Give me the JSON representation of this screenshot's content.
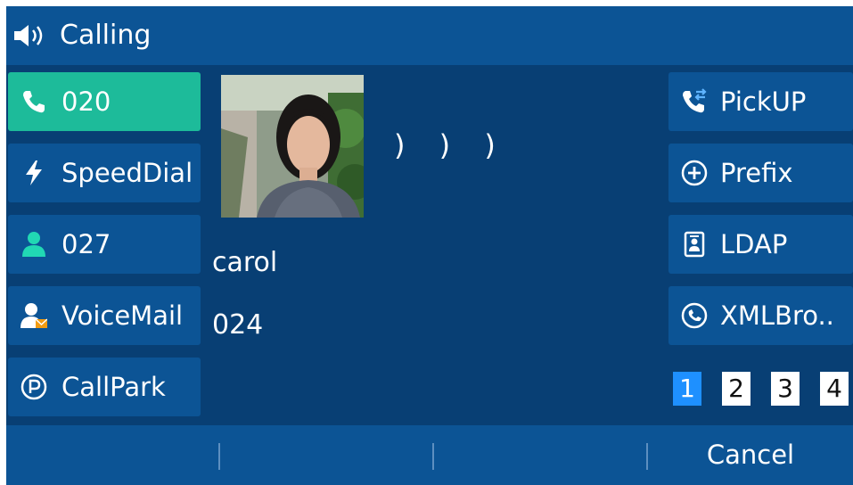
{
  "status": {
    "title": "Calling",
    "icon": "speaker-icon"
  },
  "left_buttons": [
    {
      "label": "020",
      "icon": "phone-icon",
      "active": true
    },
    {
      "label": "SpeedDial",
      "icon": "lightning-icon"
    },
    {
      "label": "027",
      "icon": "person-icon"
    },
    {
      "label": "VoiceMail",
      "icon": "voicemail-person-icon"
    },
    {
      "label": "CallPark",
      "icon": "park-icon"
    }
  ],
  "right_buttons": [
    {
      "label": "PickUP",
      "icon": "pickup-icon"
    },
    {
      "label": "Prefix",
      "icon": "plus-circle-icon"
    },
    {
      "label": "LDAP",
      "icon": "contact-card-icon"
    },
    {
      "label": "XMLBro..",
      "icon": "xml-browser-icon"
    }
  ],
  "call": {
    "ringing_indicator": ") ) )",
    "name": "carol",
    "number": "024"
  },
  "pages": {
    "items": [
      "1",
      "2",
      "3",
      "4"
    ],
    "current": "1"
  },
  "softkeys": [
    "",
    "",
    "",
    "Cancel"
  ],
  "colors": {
    "background": "#083f74",
    "button": "#0c5495",
    "active_line": "#1dbb9a",
    "page_active": "#1e90ff"
  }
}
